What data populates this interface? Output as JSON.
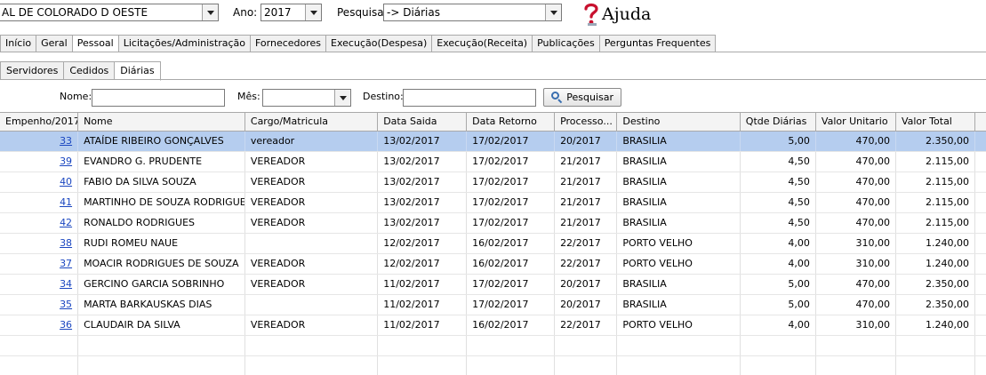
{
  "filters": {
    "entity": "AL DE COLORADO D OESTE",
    "ano_label": "Ano:",
    "ano_value": "2017",
    "pesquisa_label": "Pesquisa:",
    "pesquisa_value": "-> Diárias",
    "help_label": "Ajuda"
  },
  "tabs": [
    {
      "label": "Início"
    },
    {
      "label": "Geral"
    },
    {
      "label": "Pessoal"
    },
    {
      "label": "Licitações/Administração"
    },
    {
      "label": "Fornecedores"
    },
    {
      "label": "Execução(Despesa)"
    },
    {
      "label": "Execução(Receita)"
    },
    {
      "label": "Publicações"
    },
    {
      "label": "Perguntas Frequentes"
    }
  ],
  "subtabs": [
    {
      "label": "Servidores"
    },
    {
      "label": "Cedidos"
    },
    {
      "label": "Diárias"
    }
  ],
  "search": {
    "nome_label": "Nome:",
    "nome_value": "",
    "mes_label": "Mês:",
    "mes_value": "",
    "destino_label": "Destino:",
    "destino_value": "",
    "button_label": "Pesquisar"
  },
  "table": {
    "columns": [
      "Empenho/2017",
      "Nome",
      "Cargo/Matricula",
      "Data Saida",
      "Data Retorno",
      "Processo...",
      "Destino",
      "Qtde Diárias",
      "Valor Unitario",
      "Valor Total"
    ],
    "rows": [
      [
        "33",
        "ATAÍDE RIBEIRO GONÇALVES",
        "vereador",
        "13/02/2017",
        "17/02/2017",
        "20/2017",
        "BRASILIA",
        "5,00",
        "470,00",
        "2.350,00"
      ],
      [
        "39",
        "EVANDRO G. PRUDENTE",
        "VEREADOR",
        "13/02/2017",
        "17/02/2017",
        "21/2017",
        "BRASILIA",
        "4,50",
        "470,00",
        "2.115,00"
      ],
      [
        "40",
        "FABIO DA SILVA SOUZA",
        "VEREADOR",
        "13/02/2017",
        "17/02/2017",
        "21/2017",
        "BRASILIA",
        "4,50",
        "470,00",
        "2.115,00"
      ],
      [
        "41",
        "MARTINHO DE SOUZA RODRIGUES",
        "VEREADOR",
        "13/02/2017",
        "17/02/2017",
        "21/2017",
        "BRASILIA",
        "4,50",
        "470,00",
        "2.115,00"
      ],
      [
        "42",
        "RONALDO RODRIGUES",
        "VEREADOR",
        "13/02/2017",
        "17/02/2017",
        "21/2017",
        "BRASILIA",
        "4,50",
        "470,00",
        "2.115,00"
      ],
      [
        "38",
        "RUDI ROMEU NAUE",
        "",
        "12/02/2017",
        "16/02/2017",
        "22/2017",
        "PORTO VELHO",
        "4,00",
        "310,00",
        "1.240,00"
      ],
      [
        "37",
        "MOACIR RODRIGUES DE SOUZA",
        "VEREADOR",
        "12/02/2017",
        "16/02/2017",
        "22/2017",
        "PORTO VELHO",
        "4,00",
        "310,00",
        "1.240,00"
      ],
      [
        "34",
        "GERCINO GARCIA SOBRINHO",
        "VEREADOR",
        "11/02/2017",
        "17/02/2017",
        "20/2017",
        "BRASILIA",
        "5,00",
        "470,00",
        "2.350,00"
      ],
      [
        "35",
        "MARTA BARKAUSKAS DIAS",
        "",
        "11/02/2017",
        "17/02/2017",
        "20/2017",
        "BRASILIA",
        "5,00",
        "470,00",
        "2.350,00"
      ],
      [
        "36",
        "CLAUDAIR DA SILVA",
        "VEREADOR",
        "11/02/2017",
        "16/02/2017",
        "22/2017",
        "PORTO VELHO",
        "4,00",
        "310,00",
        "1.240,00"
      ]
    ],
    "selected_row": 0
  },
  "colors": {
    "selected_row": "#b5cdef",
    "link": "#1a46c0",
    "help_icon": "#c8102e"
  }
}
